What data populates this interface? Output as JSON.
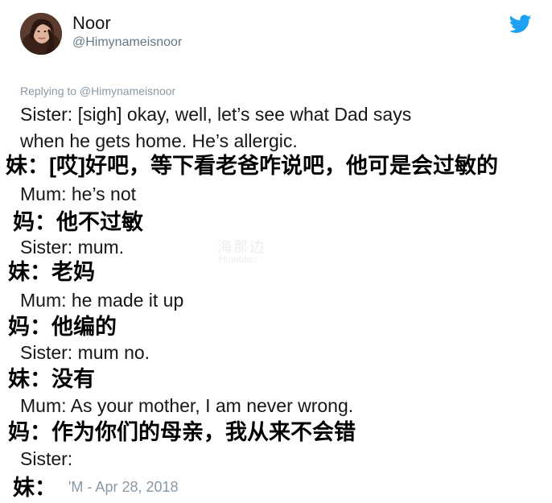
{
  "tweet": {
    "author_name": "Noor",
    "author_handle": "@Himynameisnoor",
    "replying_to": "Replying to @Himynameisnoor",
    "lines": [
      "Sister: [sigh] okay, well, let’s see what Dad says",
      "when he gets home. He’s allergic.",
      "妹：[哎]好吧，等下看老爸咋说吧，他可是会过敏的",
      "Mum: he’s not",
      "妈：他不过敏",
      "Sister: mum.",
      "妹：老妈",
      "Mum: he made it up",
      "妈：他编的",
      "Sister: mum no.",
      "妹：没有",
      "Mum: As your mother, I am never wrong.",
      "妈：作为你们的母亲，我从来不会错",
      "Sister:",
      "妹："
    ],
    "timestamp": "'M - Apr 28, 2018"
  },
  "watermark": {
    "cn": "海那边",
    "en": "Hinabian"
  },
  "icons": {
    "brand": "twitter-bird-icon",
    "avatar": "profile-avatar"
  },
  "colors": {
    "twitter_blue": "#1da1f2",
    "primary_text": "#14171a",
    "secondary_text": "#657786",
    "muted_text": "#8899a6"
  }
}
